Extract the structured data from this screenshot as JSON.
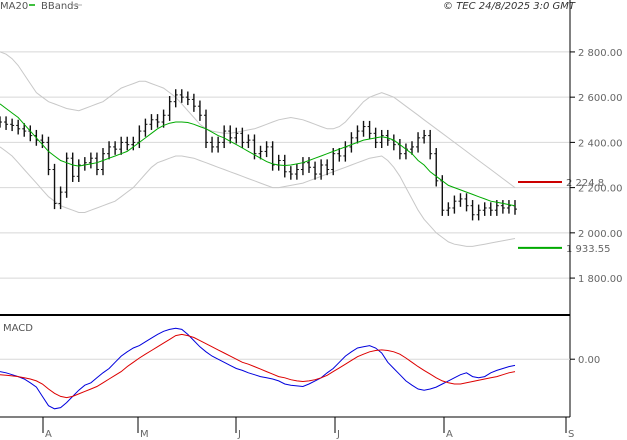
{
  "header": {
    "legend_ma": "MA20",
    "legend_bb": "BBands",
    "copyright": "© TEC 24/8/2025 3:0 GMT"
  },
  "colors": {
    "candle": "#111111",
    "ma20": "#00aa00",
    "bbands": "#c8c8c8",
    "macd": "#0000dd",
    "signal": "#dd0000",
    "marker_high": "#cc0000",
    "marker_low": "#00aa00",
    "grid": "#d8d8d8"
  },
  "chart_data": [
    {
      "type": "candlestick",
      "title": "",
      "ylim": [
        1650,
        2950
      ],
      "y_ticks": [
        {
          "value": 2800,
          "label": "2 800.00"
        },
        {
          "value": 2600,
          "label": "2 600.00"
        },
        {
          "value": 2400,
          "label": "2 400.00"
        },
        {
          "value": 2200,
          "label": "2 200.00"
        },
        {
          "value": 2000,
          "label": "2 000.00"
        },
        {
          "value": 1800,
          "label": "1 800.00"
        }
      ],
      "x_months": [
        "A",
        "M",
        "J",
        "J",
        "A",
        "S"
      ],
      "grid": true,
      "series": {
        "close": [
          2490,
          2480,
          2475,
          2460,
          2450,
          2430,
          2410,
          2400,
          2280,
          2130,
          2180,
          2330,
          2250,
          2300,
          2310,
          2330,
          2280,
          2350,
          2380,
          2370,
          2400,
          2390,
          2400,
          2450,
          2480,
          2500,
          2490,
          2520,
          2580,
          2610,
          2600,
          2590,
          2560,
          2520,
          2400,
          2380,
          2400,
          2450,
          2420,
          2440,
          2400,
          2410,
          2350,
          2360,
          2380,
          2300,
          2320,
          2270,
          2260,
          2280,
          2310,
          2290,
          2260,
          2300,
          2280,
          2350,
          2340,
          2380,
          2420,
          2450,
          2470,
          2440,
          2400,
          2430,
          2410,
          2390,
          2350,
          2370,
          2380,
          2420,
          2430,
          2350,
          2230,
          2100,
          2110,
          2140,
          2150,
          2120,
          2080,
          2100,
          2110,
          2100,
          2120,
          2110,
          2120,
          2105
        ],
        "ma20": [
          2570,
          2550,
          2530,
          2510,
          2480,
          2450,
          2420,
          2390,
          2360,
          2340,
          2320,
          2310,
          2300,
          2295,
          2300,
          2305,
          2310,
          2320,
          2330,
          2340,
          2350,
          2360,
          2380,
          2400,
          2420,
          2440,
          2460,
          2475,
          2485,
          2490,
          2490,
          2488,
          2480,
          2470,
          2460,
          2445,
          2430,
          2420,
          2405,
          2390,
          2375,
          2360,
          2345,
          2330,
          2315,
          2305,
          2300,
          2298,
          2300,
          2305,
          2310,
          2320,
          2330,
          2340,
          2350,
          2360,
          2370,
          2380,
          2390,
          2400,
          2410,
          2415,
          2420,
          2425,
          2420,
          2410,
          2390,
          2370,
          2350,
          2320,
          2300,
          2270,
          2250,
          2230,
          2210,
          2200,
          2190,
          2180,
          2170,
          2160,
          2150,
          2140,
          2135,
          2130,
          2125,
          2120
        ],
        "bb_upper": [
          2800,
          2790,
          2770,
          2740,
          2700,
          2660,
          2620,
          2600,
          2580,
          2570,
          2560,
          2550,
          2545,
          2540,
          2550,
          2560,
          2570,
          2580,
          2600,
          2620,
          2640,
          2650,
          2660,
          2670,
          2670,
          2660,
          2650,
          2640,
          2620,
          2600,
          2570,
          2540,
          2510,
          2480,
          2460,
          2450,
          2445,
          2440,
          2440,
          2445,
          2450,
          2455,
          2460,
          2470,
          2480,
          2490,
          2500,
          2505,
          2510,
          2505,
          2500,
          2490,
          2480,
          2470,
          2460,
          2460,
          2470,
          2490,
          2520,
          2550,
          2580,
          2600,
          2610,
          2620,
          2610,
          2600,
          2580,
          2560,
          2540,
          2520,
          2500,
          2480,
          2460,
          2440,
          2420,
          2400,
          2380,
          2360,
          2340,
          2320,
          2300,
          2280,
          2260,
          2240,
          2220,
          2200
        ],
        "bb_lower": [
          2380,
          2360,
          2340,
          2310,
          2280,
          2250,
          2220,
          2190,
          2160,
          2140,
          2120,
          2110,
          2100,
          2090,
          2090,
          2100,
          2110,
          2120,
          2130,
          2140,
          2160,
          2180,
          2200,
          2230,
          2260,
          2290,
          2310,
          2320,
          2330,
          2340,
          2340,
          2335,
          2330,
          2320,
          2310,
          2300,
          2290,
          2280,
          2270,
          2260,
          2250,
          2240,
          2230,
          2220,
          2210,
          2200,
          2200,
          2205,
          2210,
          2215,
          2220,
          2230,
          2240,
          2250,
          2260,
          2270,
          2280,
          2290,
          2300,
          2310,
          2320,
          2330,
          2335,
          2340,
          2320,
          2290,
          2250,
          2200,
          2150,
          2100,
          2060,
          2030,
          2000,
          1980,
          1960,
          1950,
          1945,
          1940,
          1940,
          1945,
          1950,
          1955,
          1960,
          1965,
          1970,
          1975
        ]
      },
      "markers": [
        {
          "value": 2224.8,
          "label": "2 224.8",
          "color": "#cc0000"
        },
        {
          "value": 1933.55,
          "label": "1 933.55",
          "color": "#00aa00"
        }
      ]
    },
    {
      "type": "line",
      "title": "MACD",
      "ylim": [
        -90,
        60
      ],
      "y_ticks": [
        {
          "value": 0,
          "label": "0.00"
        }
      ],
      "series": [
        {
          "name": "MACD",
          "values": [
            -20,
            -22,
            -25,
            -28,
            -32,
            -38,
            -45,
            -60,
            -75,
            -80,
            -78,
            -70,
            -60,
            -50,
            -42,
            -38,
            -30,
            -22,
            -15,
            -5,
            5,
            12,
            18,
            22,
            28,
            34,
            40,
            45,
            48,
            50,
            48,
            40,
            30,
            20,
            12,
            5,
            0,
            -5,
            -10,
            -15,
            -18,
            -22,
            -25,
            -28,
            -30,
            -32,
            -35,
            -40,
            -42,
            -43,
            -44,
            -40,
            -35,
            -30,
            -22,
            -15,
            -5,
            5,
            12,
            18,
            20,
            22,
            18,
            10,
            -5,
            -15,
            -25,
            -35,
            -42,
            -48,
            -50,
            -48,
            -45,
            -40,
            -35,
            -30,
            -25,
            -22,
            -28,
            -30,
            -28,
            -22,
            -18,
            -15,
            -12,
            -10
          ],
          "color": "#0000dd"
        },
        {
          "name": "Signal",
          "values": [
            -25,
            -26,
            -27,
            -28,
            -30,
            -32,
            -35,
            -40,
            -48,
            -55,
            -60,
            -62,
            -60,
            -56,
            -52,
            -48,
            -44,
            -38,
            -32,
            -26,
            -20,
            -12,
            -5,
            2,
            8,
            14,
            20,
            26,
            32,
            38,
            40,
            38,
            35,
            30,
            25,
            20,
            15,
            10,
            5,
            0,
            -5,
            -8,
            -12,
            -16,
            -20,
            -24,
            -28,
            -30,
            -33,
            -35,
            -36,
            -35,
            -33,
            -30,
            -26,
            -20,
            -14,
            -8,
            -2,
            4,
            8,
            12,
            14,
            15,
            14,
            12,
            8,
            2,
            -5,
            -12,
            -18,
            -24,
            -30,
            -35,
            -38,
            -40,
            -40,
            -38,
            -36,
            -34,
            -32,
            -30,
            -28,
            -25,
            -22,
            -20
          ],
          "color": "#dd0000"
        }
      ]
    }
  ]
}
